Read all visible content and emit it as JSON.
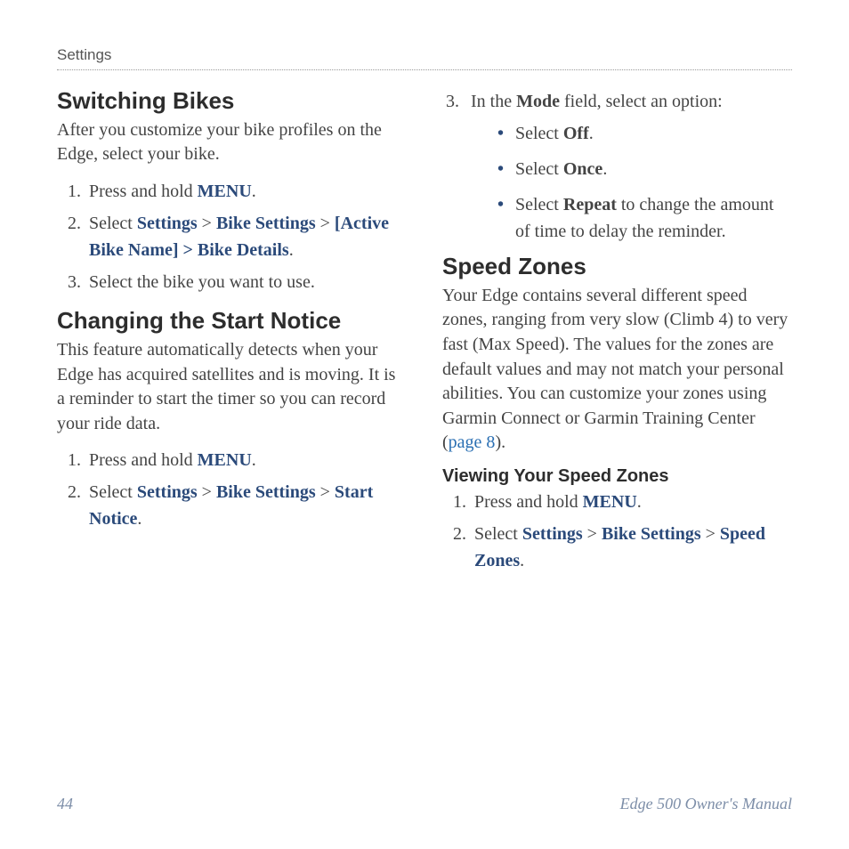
{
  "running_head": "Settings",
  "left": {
    "h1": "Switching Bikes",
    "p1": "After you customize your bike profiles on the Edge, select your bike.",
    "s1_1a": "Press and hold ",
    "s1_1b_menu": "MENU",
    "s1_1c": ".",
    "s1_2a": "Select ",
    "s1_2b_settings": "Settings",
    "s1_2c": " > ",
    "s1_2d_bike": "Bike Settings",
    "s1_2e": " > ",
    "s1_2f_active": "[Active Bike Name] > Bike Details",
    "s1_2g": ".",
    "s1_3": "Select the bike you want to use.",
    "h2": "Changing the Start Notice",
    "p2": "This feature automatically detects when your Edge has acquired satellites and is moving. It is a reminder to start the timer so you can record your ride data.",
    "s2_1a": "Press and hold ",
    "s2_1b_menu": "MENU",
    "s2_1c": ".",
    "s2_2a": "Select ",
    "s2_2b_settings": "Settings",
    "s2_2c": " > ",
    "s2_2d_bike": "Bike Settings",
    "s2_2e": " > ",
    "s2_2f_start": "Start Notice",
    "s2_2g": "."
  },
  "right": {
    "s3_num": "3.",
    "s3_a": "In the ",
    "s3_b_mode": "Mode",
    "s3_c": " field, select an option:",
    "bul1a": "Select ",
    "bul1b_off": "Off",
    "bul1c": ".",
    "bul2a": "Select ",
    "bul2b_once": "Once",
    "bul2c": ".",
    "bul3a": "Select ",
    "bul3b_repeat": "Repeat",
    "bul3c": " to change the amount of time to delay the reminder.",
    "h3": "Speed Zones",
    "p3a": "Your Edge contains several different speed zones, ranging from very slow (Climb 4) to very fast (Max Speed). The values for the zones are default values and may not match your personal abilities. You can customize your zones using Garmin Connect or Garmin Training Center (",
    "p3b_link": "page 8",
    "p3c": ").",
    "h4": "Viewing Your Speed Zones",
    "s4_1a": "Press and hold ",
    "s4_1b_menu": "MENU",
    "s4_1c": ".",
    "s4_2a": "Select ",
    "s4_2b_settings": "Settings",
    "s4_2c": " > ",
    "s4_2d_bike": "Bike Settings",
    "s4_2e": " > ",
    "s4_2f_speed": "Speed Zones",
    "s4_2g": "."
  },
  "footer": {
    "page_num": "44",
    "doc_title": "Edge 500 Owner's Manual"
  }
}
